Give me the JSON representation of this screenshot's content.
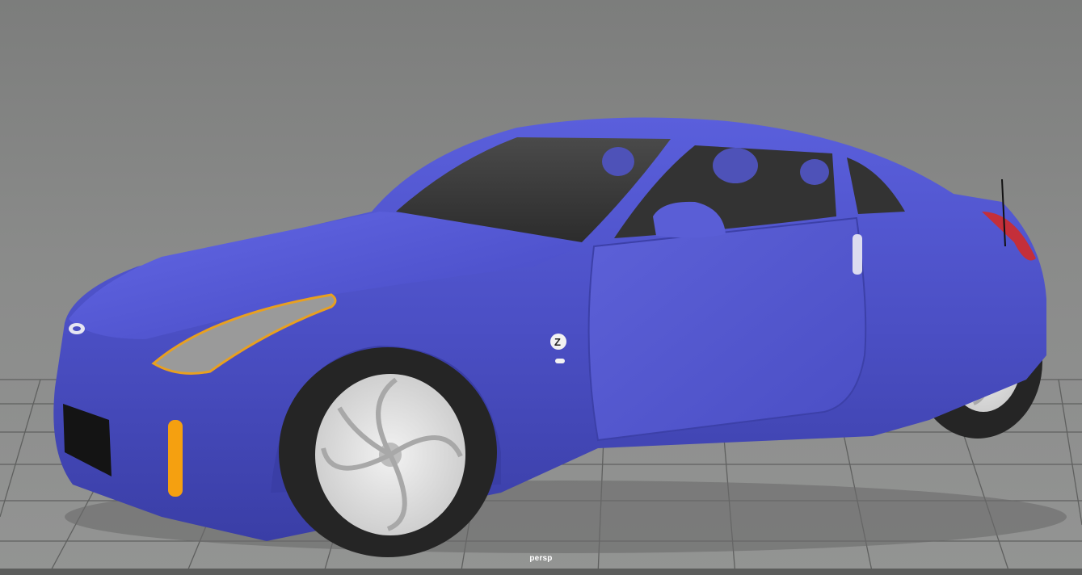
{
  "viewport": {
    "camera_name": "persp",
    "background_color": "#8a8b8a",
    "grid": true,
    "grid_color": "#5f605f"
  },
  "model": {
    "paint_color": "#4b4fc4",
    "rim_color": "#e4e4e4",
    "tire_color": "#252525",
    "glass_color": "#3a3a3a",
    "headlight_accent": "#e8a020",
    "side_marker_color": "#f5a010",
    "taillight_color": "#c42f3a"
  },
  "icons": [
    "car-badge-icon",
    "z-emblem-icon"
  ]
}
